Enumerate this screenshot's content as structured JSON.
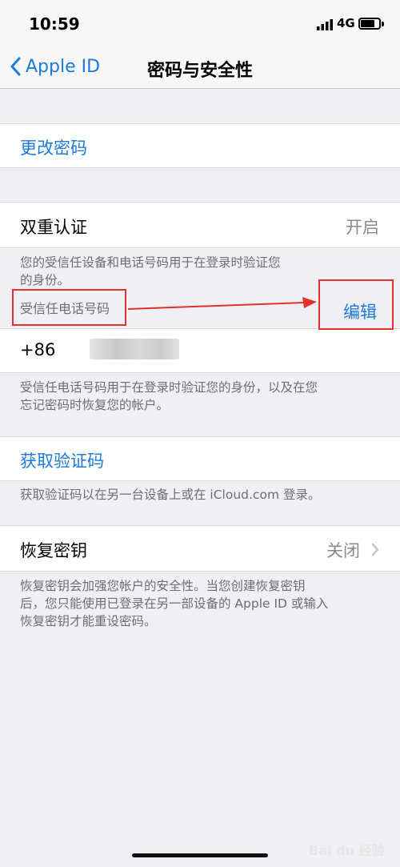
{
  "status_bar": {
    "time": "10:59",
    "network": "4G"
  },
  "nav": {
    "back_label": "Apple ID",
    "title": "密码与安全性"
  },
  "change_password": {
    "label": "更改密码"
  },
  "two_factor": {
    "label": "双重认证",
    "value": "开启",
    "description_line1": "您的受信任设备和电话号码用于在登录时验证您",
    "description_line2": "的身份。",
    "trusted_numbers_header": "受信任电话号码",
    "edit_label": "编辑",
    "phone_prefix": "+86",
    "phone_footer_line1": "受信任电话号码用于在登录时验证您的身份，以及在您",
    "phone_footer_line2": "忘记密码时恢复您的帐户。"
  },
  "get_code": {
    "label": "获取验证码",
    "footer": "获取验证码以在另一台设备上或在 iCloud.com 登录。"
  },
  "recovery_key": {
    "label": "恢复密钥",
    "value": "关闭",
    "footer_line1": "恢复密钥会加强您帐户的安全性。当您创建恢复密钥",
    "footer_line2": "后，您只能使用已登录在另一部设备的 Apple ID 或输入",
    "footer_line3": "恢复密钥才能重设密码。"
  },
  "watermark": "Bai du 经验",
  "colors": {
    "accent": "#1a7ae0",
    "annotation": "#e0322c",
    "background": "#efeff4"
  }
}
